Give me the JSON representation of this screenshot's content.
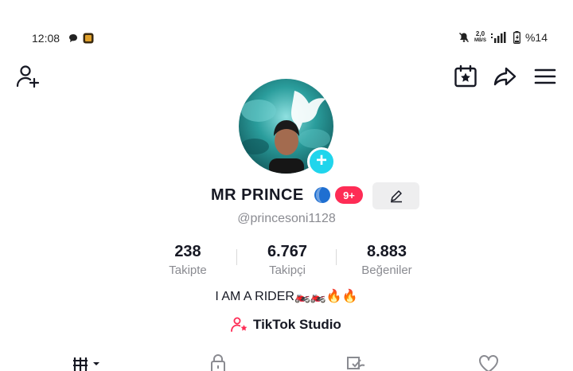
{
  "status_bar": {
    "time": "12:08",
    "net_speed_value": "2,0",
    "net_speed_unit": "MB/S",
    "battery": "%14"
  },
  "profile": {
    "display_name": "MR PRINCE",
    "notification_badge": "9+",
    "username": "@princesoni1128",
    "bio": "I AM A RIDER🏍️🏍️🔥🔥",
    "studio_link": "TikTok Studio"
  },
  "stats": [
    {
      "value": "238",
      "label": "Takipte"
    },
    {
      "value": "6.767",
      "label": "Takipçi"
    },
    {
      "value": "8.883",
      "label": "Beğeniler"
    }
  ],
  "icons": {
    "add_friend": "add-user-icon",
    "calendar": "calendar-star-icon",
    "share": "share-arrow-icon",
    "menu": "hamburger-menu-icon",
    "tabs": [
      "videos-grid-icon",
      "lock-icon",
      "reposts-icon",
      "heart-icon"
    ]
  },
  "colors": {
    "accent_cyan": "#20d5ec",
    "badge_red": "#fe2c55",
    "secondary_text": "#8a8b91"
  }
}
